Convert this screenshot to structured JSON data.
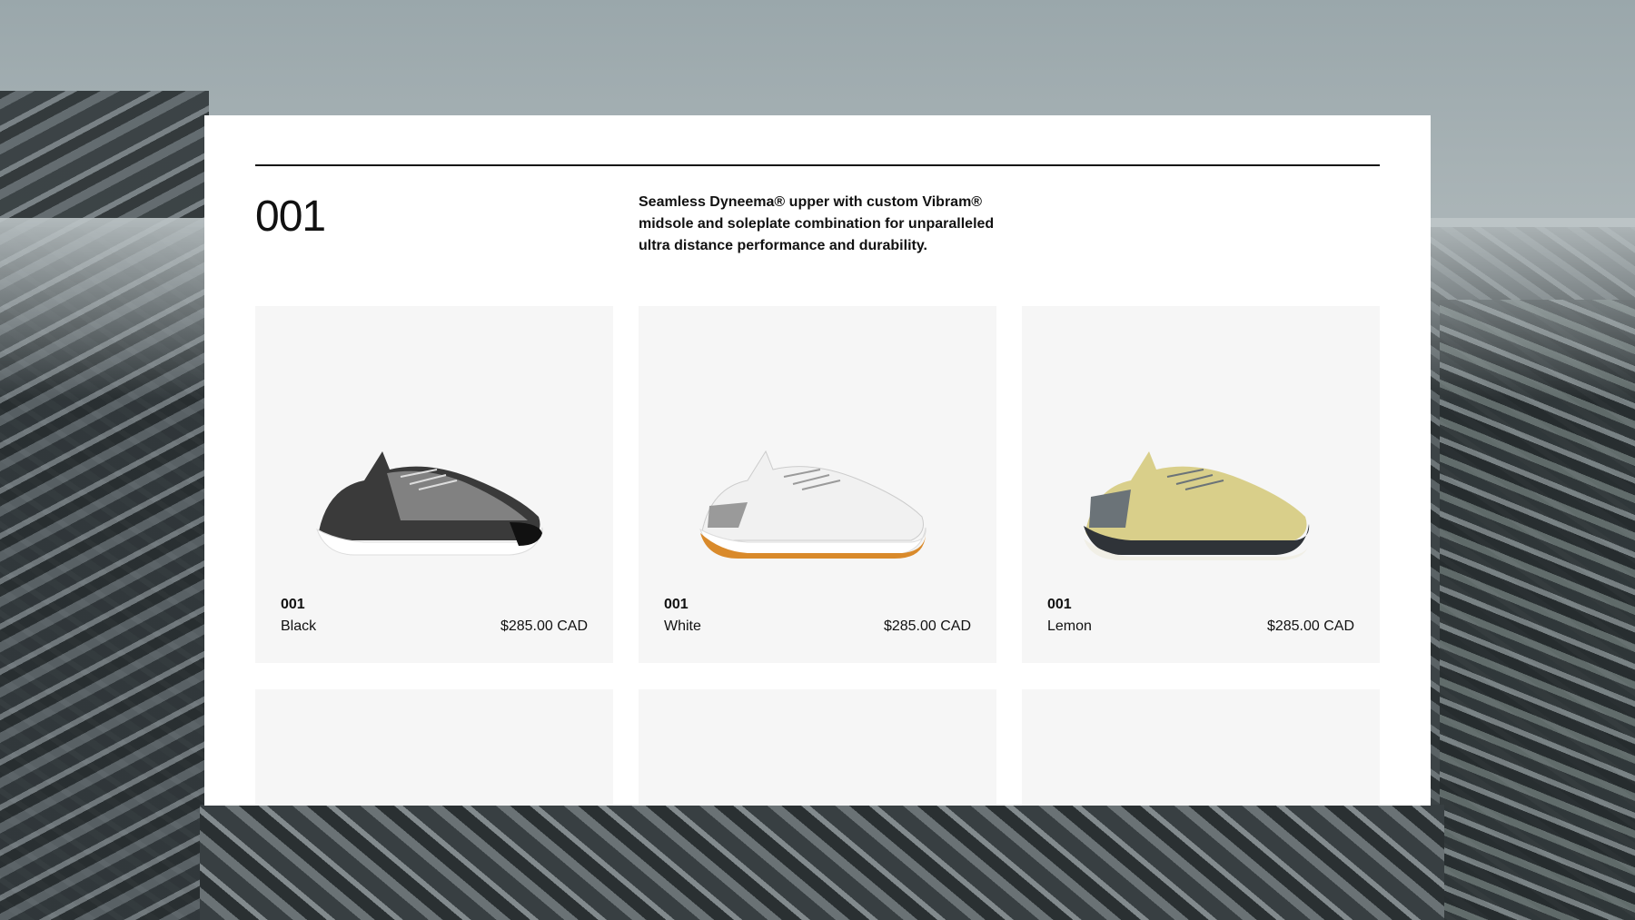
{
  "section": {
    "title": "001",
    "description": "Seamless Dyneema® upper with custom Vibram® midsole and soleplate combination for unparalleled ultra distance performance and durability."
  },
  "products": [
    {
      "code": "001",
      "color": "Black",
      "price": "$285.00 CAD",
      "upper": "#3a3a3a",
      "upper_accent": "#8a8a8a",
      "sole": "#ffffff",
      "outsole": "#111111"
    },
    {
      "code": "001",
      "color": "White",
      "price": "$285.00 CAD",
      "upper": "#f1f1f1",
      "upper_accent": "#9a9a9a",
      "sole": "#ffffff",
      "outsole": "#d98a2b"
    },
    {
      "code": "001",
      "color": "Lemon",
      "price": "$285.00 CAD",
      "upper": "#d9cf8a",
      "upper_accent": "#6b7378",
      "sole": "#2f3338",
      "outsole": "#f1efe6"
    }
  ]
}
